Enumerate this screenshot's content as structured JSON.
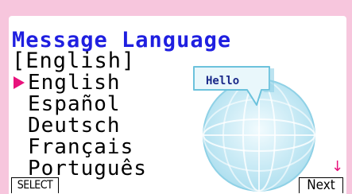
{
  "screen": {
    "title": "Message Language",
    "current_selection": "[English]"
  },
  "languages": [
    {
      "label": "English",
      "selected": true
    },
    {
      "label": "Español",
      "selected": false
    },
    {
      "label": "Deutsch",
      "selected": false
    },
    {
      "label": "Français",
      "selected": false
    },
    {
      "label": "Português",
      "selected": false
    }
  ],
  "preview": {
    "bubble_text": "Hello",
    "icon": "globe-icon"
  },
  "scroll_indicator": {
    "glyph": "↓",
    "icon": "down-arrow-icon"
  },
  "function_keys": {
    "f1": "SELECT",
    "f6": "Next"
  },
  "colors": {
    "frame": "#f7c6dd",
    "title": "#1f1fe0",
    "cursor": "#e8127c",
    "globe": "#bfe8f2"
  }
}
